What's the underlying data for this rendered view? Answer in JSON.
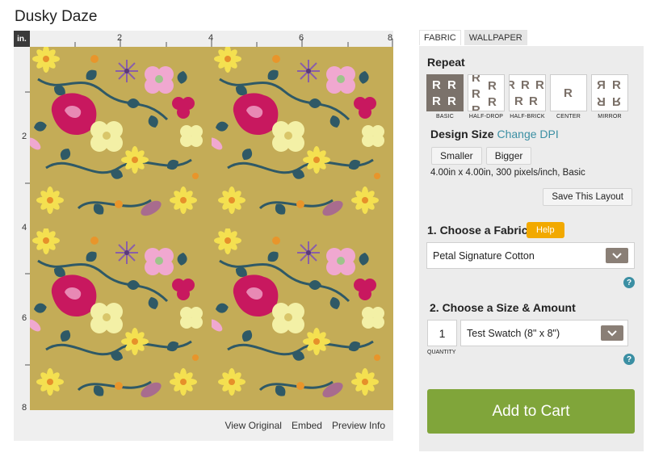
{
  "page": {
    "title": "Dusky Daze"
  },
  "preview": {
    "unit_badge": "in.",
    "ruler_top_labels": [
      "2",
      "4",
      "6",
      "8"
    ],
    "ruler_left_labels": [
      "2",
      "4",
      "6",
      "8"
    ],
    "links": {
      "view_original": "View Original",
      "embed": "Embed",
      "preview_info": "Preview Info"
    }
  },
  "tabs": {
    "fabric": "FABRIC",
    "wallpaper": "WALLPAPER"
  },
  "repeat": {
    "title": "Repeat",
    "options": [
      {
        "label": "BASIC",
        "selected": true
      },
      {
        "label": "HALF-DROP",
        "selected": false
      },
      {
        "label": "HALF-BRICK",
        "selected": false
      },
      {
        "label": "CENTER",
        "selected": false
      },
      {
        "label": "MIRROR",
        "selected": false
      }
    ],
    "tile_letter": "R"
  },
  "design_size": {
    "label": "Design Size",
    "change_dpi": "Change DPI",
    "smaller": "Smaller",
    "bigger": "Bigger",
    "dimensions": "4.00in x 4.00in, 300 pixels/inch, Basic",
    "save_layout": "Save This Layout"
  },
  "step1": {
    "label": "1. Choose a Fabric",
    "help": "Help",
    "fabric_value": "Petal Signature Cotton",
    "help_icon": "?"
  },
  "step2": {
    "label": "2. Choose a Size & Amount",
    "quantity": "1",
    "quantity_label": "QUANTITY",
    "size_value": "Test Swatch (8\" x 8\")",
    "help_icon": "?"
  },
  "cart": {
    "label": "Add to Cart"
  },
  "colors": {
    "fabric_background": "#c4ac57",
    "repeat_selected": "#7b726b",
    "link": "#3b8fa3",
    "help_button": "#f2a900",
    "add_to_cart": "#80a53a"
  }
}
